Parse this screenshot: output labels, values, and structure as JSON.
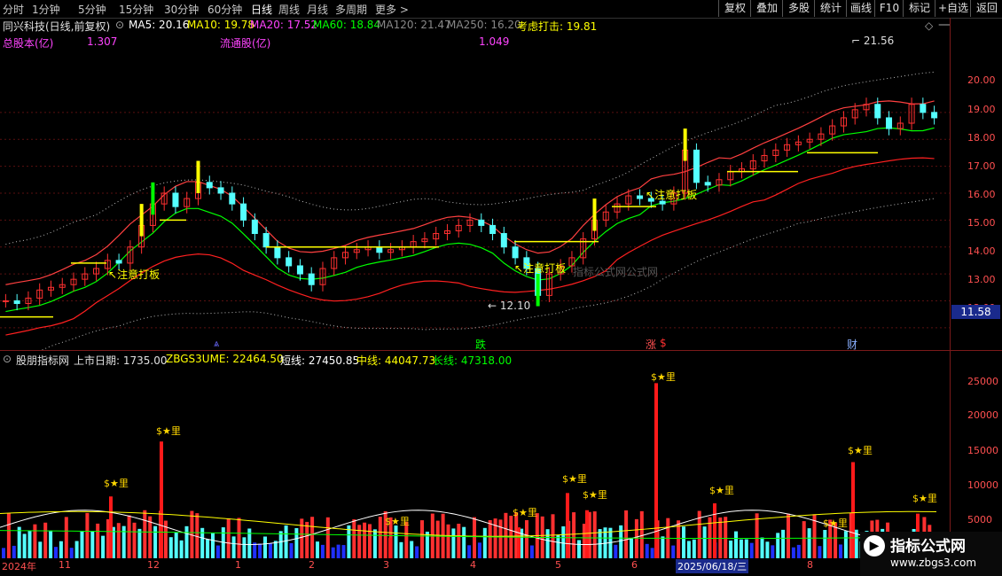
{
  "toolbar": {
    "period_tabs": [
      "分时",
      "1分钟",
      "5分钟",
      "15分钟",
      "30分钟",
      "60分钟",
      "日线",
      "周线",
      "月线",
      "多周期",
      "更多 >"
    ],
    "active_tab": "日线",
    "right_buttons": [
      "复权",
      "叠加",
      "多股",
      "统计",
      "画线",
      "F10",
      "标记",
      "+自选",
      "返回"
    ]
  },
  "main": {
    "title": "同兴科技(日线,前复权)",
    "ma": [
      {
        "label": "MA5: 20.16",
        "color": "#ffffff"
      },
      {
        "label": "MA10: 19.78",
        "color": "#ffff00"
      },
      {
        "label": "MA20: 17.52",
        "color": "#ff44ff"
      },
      {
        "label": "MA60: 18.84",
        "color": "#00ff00"
      },
      {
        "label": "MA120: 21.47",
        "color": "#888888"
      },
      {
        "label": "MA250: 16.20",
        "color": "#888888"
      }
    ],
    "strike_label": "考虑打击: 19.81",
    "total_shares_label": "总股本(亿)",
    "total_shares_value": "1.307",
    "float_shares_label": "流通股(亿)",
    "float_shares_value": "1.049",
    "high_marker": "21.56",
    "low_marker": "12.10",
    "annotation": "注意打板",
    "current_price": "11.58",
    "y_ticks": [
      "20.00",
      "19.00",
      "18.00",
      "17.00",
      "16.00",
      "15.00",
      "14.00",
      "13.00",
      "12.00"
    ],
    "events": [
      "跌",
      "涨",
      "财"
    ],
    "watermark": "指标公式网公式网"
  },
  "sub": {
    "title": "股朋指标网",
    "listing_days": "上市日期: 1735.00",
    "zbgs": "ZBGS3UME: 22464.50",
    "short_line": "短线: 27450.85",
    "mid_line": "中线: 44047.73",
    "long_line": "长线: 47318.00",
    "y_ticks": [
      "25000",
      "20000",
      "15000",
      "10000",
      "5000"
    ],
    "star_label": "★里"
  },
  "date_axis": {
    "ticks": [
      "2024年",
      "11",
      "12",
      "1",
      "2",
      "3",
      "4",
      "5",
      "6",
      "2025/06/18/三",
      "8"
    ]
  },
  "brand": {
    "name": "指标公式网",
    "url": "www.zbgs3.com"
  },
  "colors": {
    "up": "#ff3030",
    "down": "#54ffff",
    "ma_green": "#00ff00",
    "band_red": "#ff2020",
    "yellow": "#ffff00"
  },
  "chart_data": {
    "type": "candlestick",
    "price_range": [
      11.5,
      21.8
    ],
    "closes": [
      13.0,
      12.9,
      13.1,
      13.4,
      13.5,
      13.6,
      13.8,
      14.0,
      14.2,
      14.5,
      14.4,
      15.0,
      15.8,
      16.6,
      17.0,
      16.5,
      16.8,
      17.4,
      17.2,
      17.0,
      16.6,
      16.0,
      15.5,
      15.0,
      14.6,
      14.3,
      14.0,
      13.6,
      14.2,
      14.6,
      14.8,
      14.9,
      15.0,
      14.8,
      14.9,
      15.0,
      15.2,
      15.3,
      15.5,
      15.6,
      15.8,
      16.0,
      15.8,
      15.5,
      15.0,
      14.6,
      14.2,
      13.2,
      14.0,
      14.3,
      14.6,
      15.3,
      16.0,
      16.3,
      16.6,
      16.9,
      16.8,
      16.7,
      16.6,
      17.0,
      18.6,
      17.4,
      17.3,
      17.5,
      17.8,
      17.9,
      18.2,
      18.4,
      18.6,
      18.8,
      18.9,
      19.0,
      19.2,
      19.5,
      19.8,
      20.1,
      20.3,
      19.8,
      19.4,
      19.6,
      20.3,
      20.0,
      19.8
    ]
  }
}
